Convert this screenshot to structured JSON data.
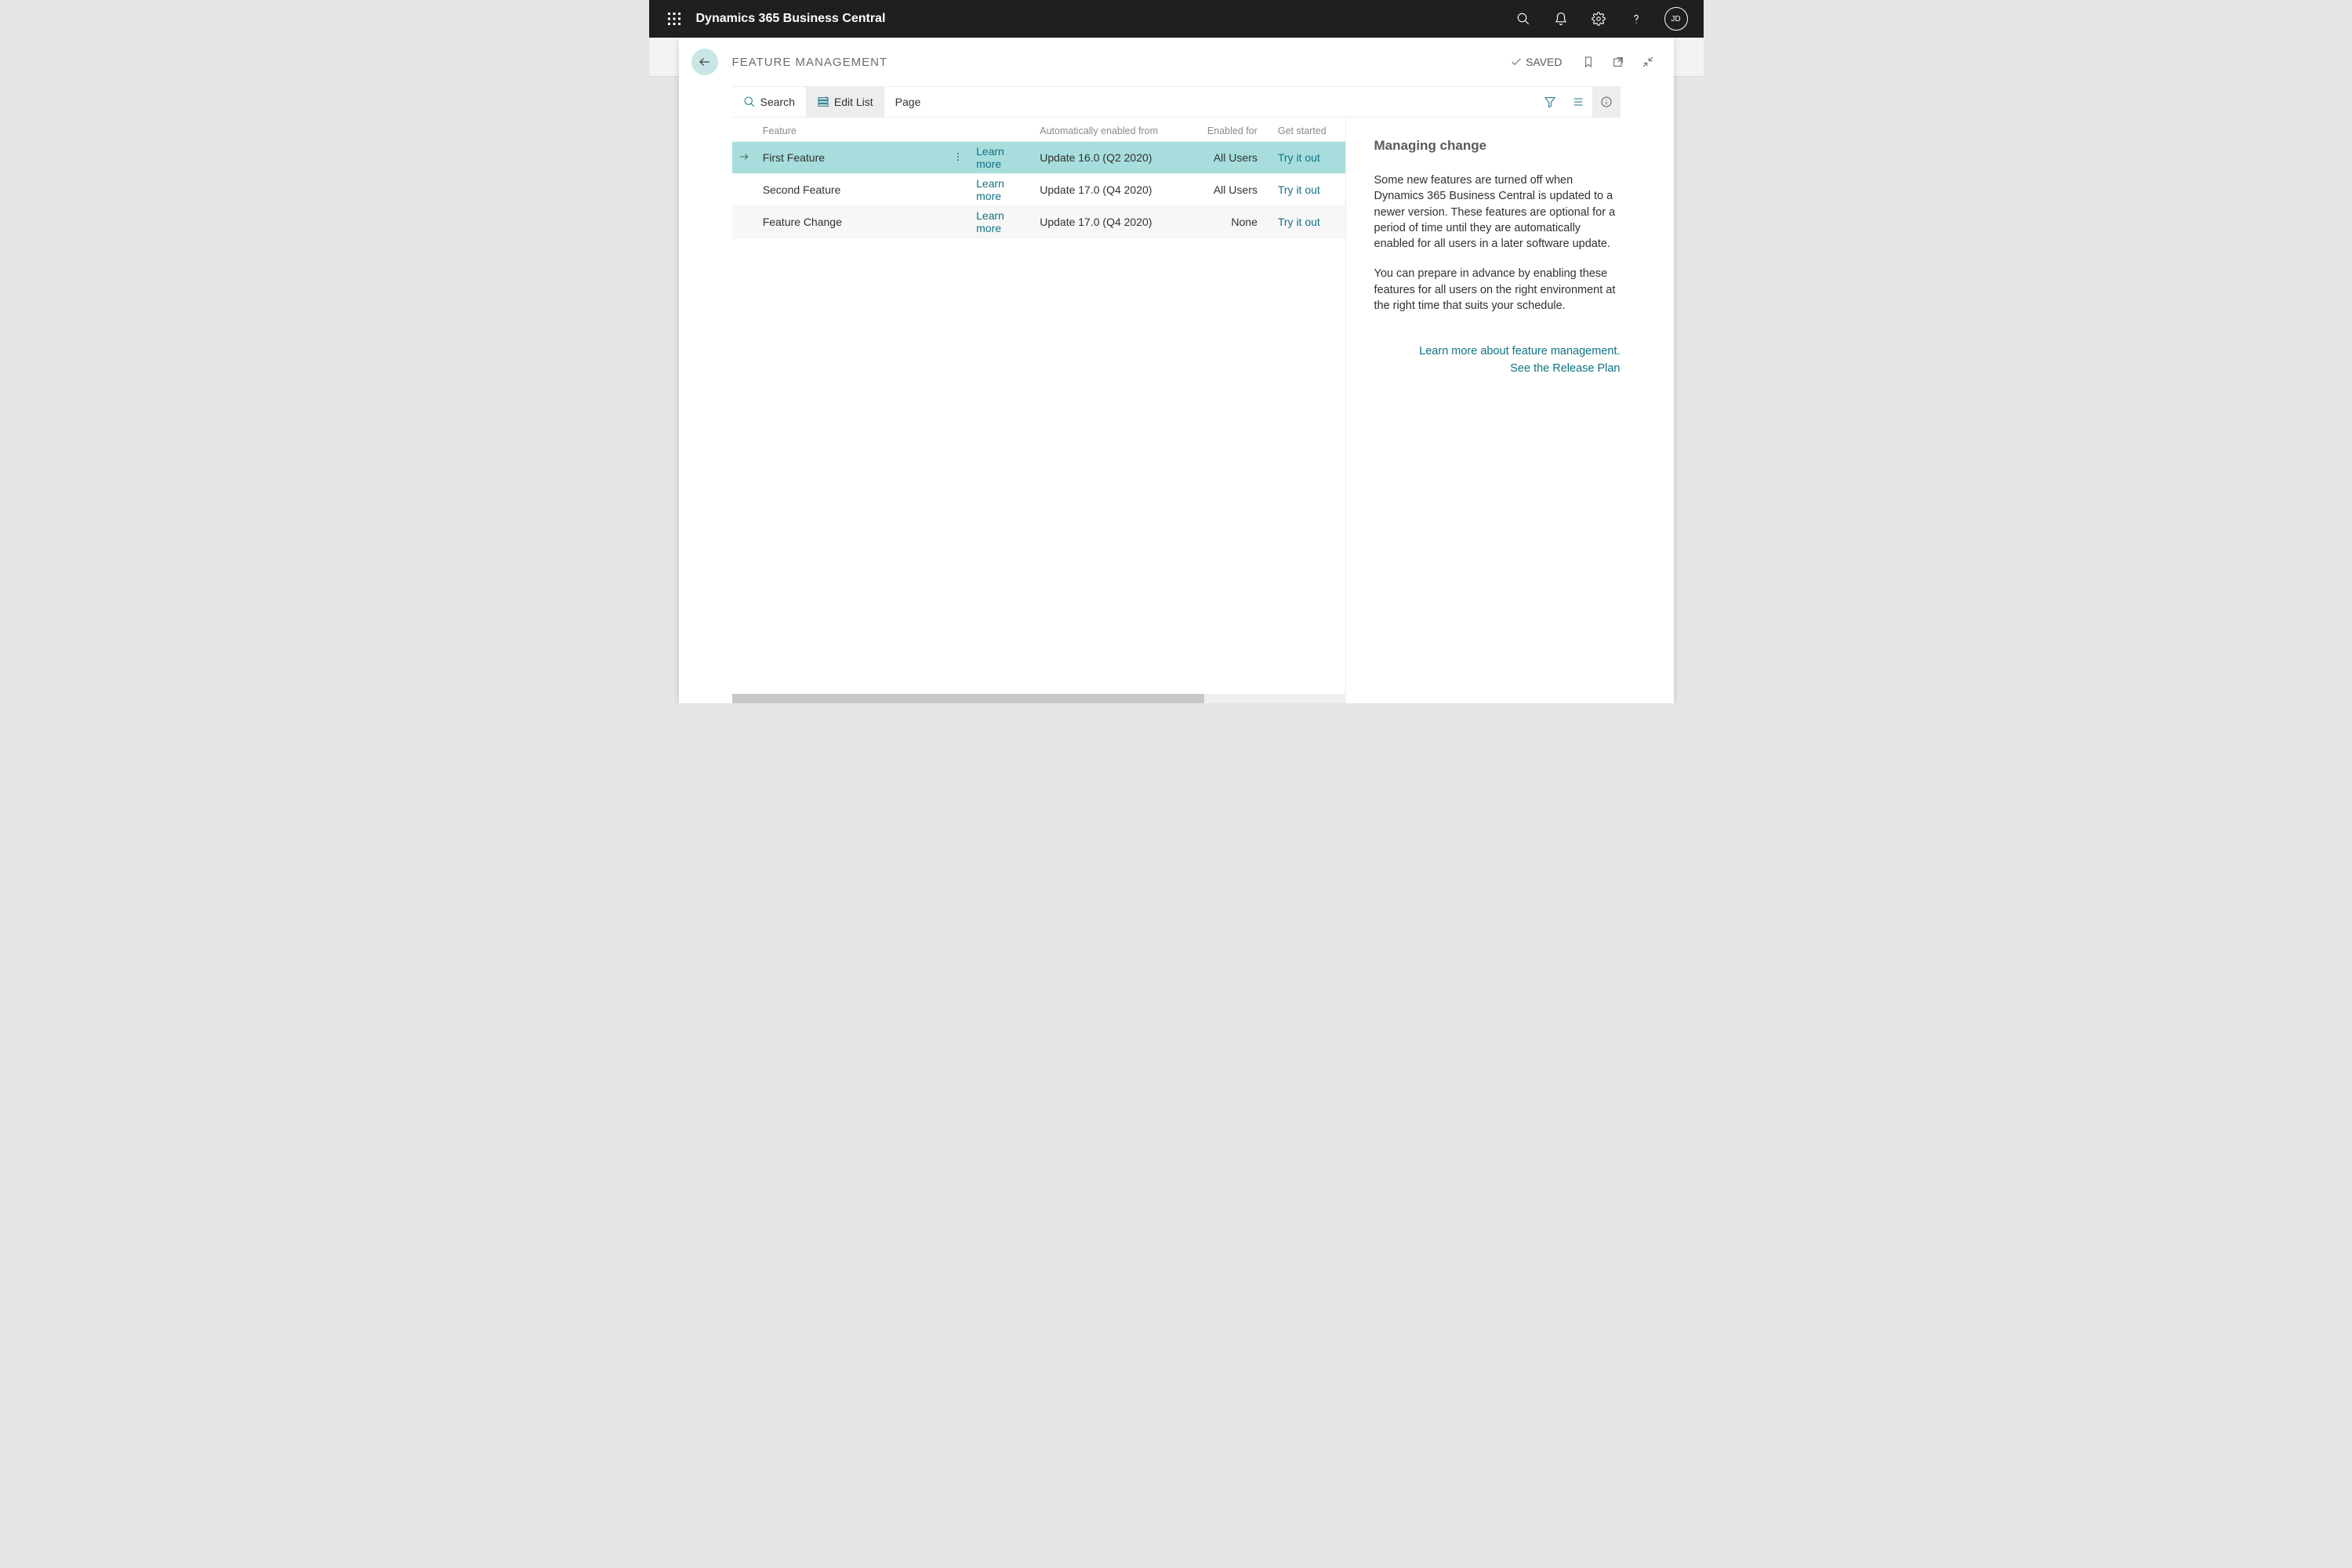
{
  "header": {
    "app_title": "Dynamics 365 Business Central",
    "avatar_initials": "JD"
  },
  "page": {
    "title": "FEATURE MANAGEMENT",
    "saved_label": "SAVED"
  },
  "toolbar": {
    "search_label": "Search",
    "edit_list_label": "Edit List",
    "page_label": "Page"
  },
  "table": {
    "columns": {
      "feature": "Feature",
      "auto_enabled": "Automatically enabled from",
      "enabled_for": "Enabled for",
      "get_started": "Get started"
    },
    "learn_more_label": "Learn more",
    "try_it_label": "Try it out",
    "rows": [
      {
        "feature": "First Feature",
        "auto": "Update 16.0 (Q2 2020)",
        "enabled": "All Users",
        "selected": true
      },
      {
        "feature": "Second Feature",
        "auto": "Update 17.0 (Q4 2020)",
        "enabled": "All Users",
        "selected": false
      },
      {
        "feature": "Feature Change",
        "auto": "Update 17.0 (Q4 2020)",
        "enabled": "None",
        "selected": false
      }
    ]
  },
  "info": {
    "title": "Managing change",
    "para1": "Some new features are turned off when Dynamics 365 Business Central is updated to a newer version. These features are optional for a period of time until they are automatically enabled for all users in a later software update.",
    "para2": "You can prepare in advance by enabling these features for all users on the right environment at the right time that suits your schedule.",
    "link1": "Learn more about feature management.",
    "link2": "See the Release Plan"
  }
}
